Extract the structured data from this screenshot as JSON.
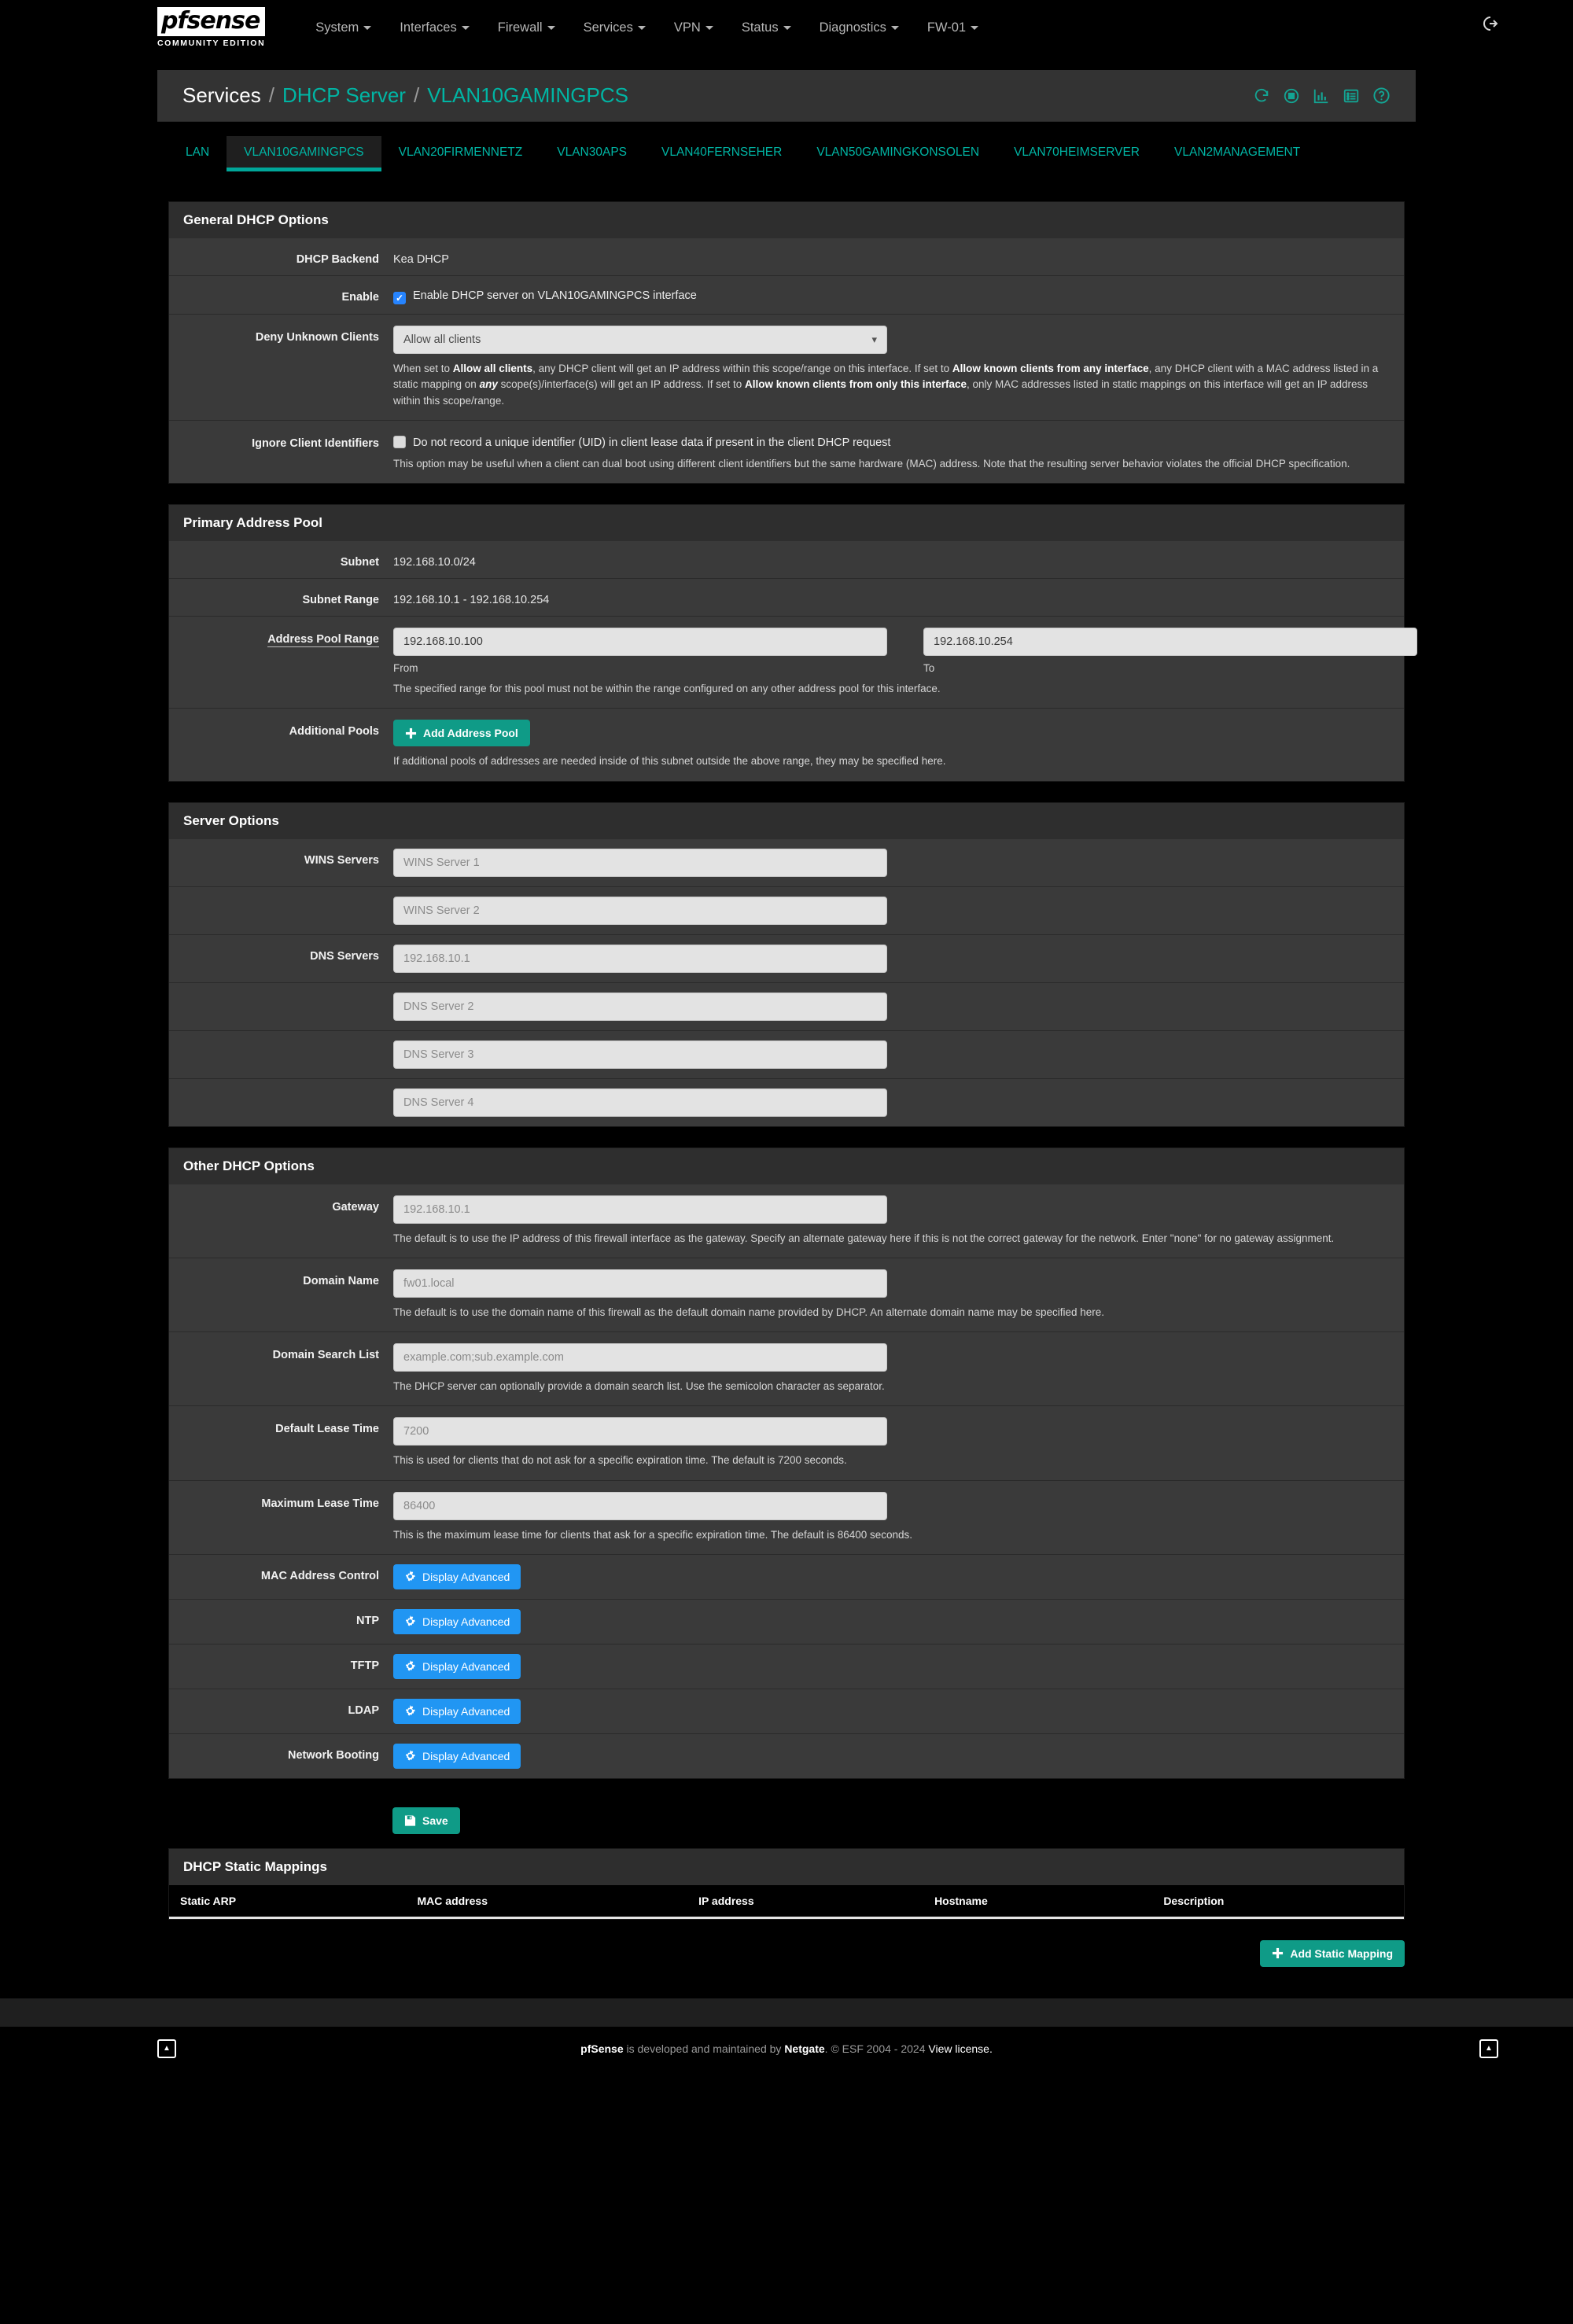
{
  "navbar": {
    "brand": "pfsense",
    "brand_sub": "COMMUNITY EDITION",
    "items": [
      {
        "label": "System",
        "caret": true
      },
      {
        "label": "Interfaces",
        "caret": true
      },
      {
        "label": "Firewall",
        "caret": true
      },
      {
        "label": "Services",
        "caret": true
      },
      {
        "label": "VPN",
        "caret": true
      },
      {
        "label": "Status",
        "caret": true
      },
      {
        "label": "Diagnostics",
        "caret": true
      },
      {
        "label": "FW-01",
        "caret": true
      }
    ],
    "logout_icon": "logout-icon"
  },
  "breadcrumb": {
    "root": "Services",
    "sep": "/",
    "section": "DHCP Server",
    "current": "VLAN10GAMINGPCS",
    "icons": [
      "restart-service-icon",
      "stop-service-icon",
      "dhcp-status-icon",
      "dhcp-leases-icon",
      "help-icon"
    ],
    "accent": "#00b5a4"
  },
  "tabs": [
    {
      "label": "LAN",
      "active": false
    },
    {
      "label": "VLAN10GAMINGPCS",
      "active": true
    },
    {
      "label": "VLAN20FIRMENNETZ",
      "active": false
    },
    {
      "label": "VLAN30APS",
      "active": false
    },
    {
      "label": "VLAN40FERNSEHER",
      "active": false
    },
    {
      "label": "VLAN50GAMINGKONSOLEN",
      "active": false
    },
    {
      "label": "VLAN70HEIMSERVER",
      "active": false
    },
    {
      "label": "VLAN2MANAGEMENT",
      "active": false
    }
  ],
  "general": {
    "title": "General DHCP Options",
    "backend_label": "DHCP Backend",
    "backend_value": "Kea DHCP",
    "enable_label": "Enable",
    "enable_checkbox_text": "Enable DHCP server on VLAN10GAMINGPCS interface",
    "enable_checked": true,
    "deny_label": "Deny Unknown Clients",
    "deny_value": "Allow all clients",
    "deny_help_1": "When set to ",
    "deny_help_b1": "Allow all clients",
    "deny_help_2": ", any DHCP client will get an IP address within this scope/range on this interface. If set to ",
    "deny_help_b2": "Allow known clients from any interface",
    "deny_help_3": ", any DHCP client with a MAC address listed in a static mapping on ",
    "deny_help_i1": "any",
    "deny_help_4": " scope(s)/interface(s) will get an IP address. If set to ",
    "deny_help_b3": "Allow known clients from only this interface",
    "deny_help_5": ", only MAC addresses listed in static mappings on this interface will get an IP address within this scope/range.",
    "ignore_label": "Ignore Client Identifiers",
    "ignore_checkbox_text": "Do not record a unique identifier (UID) in client lease data if present in the client DHCP request",
    "ignore_checked": false,
    "ignore_help": "This option may be useful when a client can dual boot using different client identifiers but the same hardware (MAC) address. Note that the resulting server behavior violates the official DHCP specification."
  },
  "pool": {
    "title": "Primary Address Pool",
    "subnet_label": "Subnet",
    "subnet_value": "192.168.10.0/24",
    "range_label": "Subnet Range",
    "range_value": "192.168.10.1 - 192.168.10.254",
    "pool_label": "Address Pool Range",
    "pool_from_value": "192.168.10.100",
    "pool_to_value": "192.168.10.254",
    "from_sublabel": "From",
    "to_sublabel": "To",
    "pool_help": "The specified range for this pool must not be within the range configured on any other address pool for this interface.",
    "additional_label": "Additional Pools",
    "add_pool_button": "Add Address Pool",
    "additional_help": "If additional pools of addresses are needed inside of this subnet outside the above range, they may be specified here."
  },
  "server_options": {
    "title": "Server Options",
    "wins_label": "WINS Servers",
    "wins": [
      {
        "placeholder": "WINS Server 1",
        "value": ""
      },
      {
        "placeholder": "WINS Server 2",
        "value": ""
      }
    ],
    "dns_label": "DNS Servers",
    "dns": [
      {
        "placeholder": "192.168.10.1",
        "value": ""
      },
      {
        "placeholder": "DNS Server 2",
        "value": ""
      },
      {
        "placeholder": "DNS Server 3",
        "value": ""
      },
      {
        "placeholder": "DNS Server 4",
        "value": ""
      }
    ]
  },
  "other_options": {
    "title": "Other DHCP Options",
    "gateway_label": "Gateway",
    "gateway_placeholder": "192.168.10.1",
    "gateway_help": "The default is to use the IP address of this firewall interface as the gateway. Specify an alternate gateway here if this is not the correct gateway for the network. Enter \"none\" for no gateway assignment.",
    "domain_label": "Domain Name",
    "domain_placeholder": "fw01.local",
    "domain_help": "The default is to use the domain name of this firewall as the default domain name provided by DHCP. An alternate domain name may be specified here.",
    "search_label": "Domain Search List",
    "search_placeholder": "example.com;sub.example.com",
    "search_help": "The DHCP server can optionally provide a domain search list. Use the semicolon character as separator.",
    "default_lease_label": "Default Lease Time",
    "default_lease_placeholder": "7200",
    "default_lease_help": "This is used for clients that do not ask for a specific expiration time. The default is 7200 seconds.",
    "max_lease_label": "Maximum Lease Time",
    "max_lease_placeholder": "86400",
    "max_lease_help": "This is the maximum lease time for clients that ask for a specific expiration time. The default is 86400 seconds.",
    "advanced_rows": [
      {
        "label": "MAC Address Control",
        "button": "Display Advanced"
      },
      {
        "label": "NTP",
        "button": "Display Advanced"
      },
      {
        "label": "TFTP",
        "button": "Display Advanced"
      },
      {
        "label": "LDAP",
        "button": "Display Advanced"
      },
      {
        "label": "Network Booting",
        "button": "Display Advanced"
      }
    ]
  },
  "save_button": "Save",
  "static_mappings": {
    "title": "DHCP Static Mappings",
    "columns": [
      "Static ARP",
      "MAC address",
      "IP address",
      "Hostname",
      "Description"
    ],
    "rows": [],
    "add_button": "Add Static Mapping"
  },
  "footer": {
    "brand": "pfSense",
    "text_1": " is developed and maintained by ",
    "company": "Netgate",
    "text_2": ". © ESF 2004 - 2024 ",
    "license": "View license.",
    "left_btn": "▲",
    "right_btn": "▲"
  }
}
